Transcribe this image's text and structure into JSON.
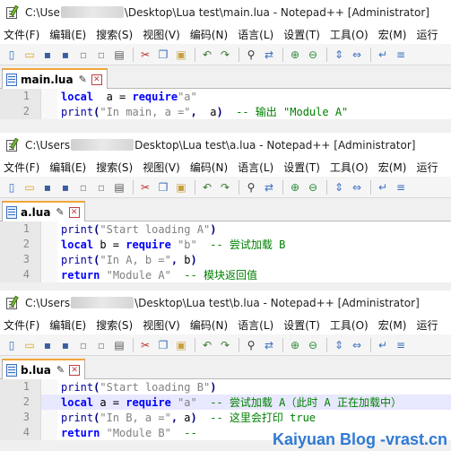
{
  "windows": [
    {
      "title_prefix": "C:\\Use",
      "title_suffix": "\\Desktop\\Lua test\\main.lua - Notepad++ [Administrator]",
      "tab_label": "main.lua",
      "lines": [
        {
          "num": "1",
          "segs": [
            [
              "kw",
              "local"
            ],
            [
              "",
              "  a = "
            ],
            [
              "kw",
              "require"
            ],
            [
              "",
              ""
            ],
            [
              "str",
              "\"a\""
            ]
          ]
        },
        {
          "num": "2",
          "segs": [
            [
              "fn",
              "print"
            ],
            [
              "op",
              "("
            ],
            [
              "str",
              "\"In main, a =\""
            ],
            [
              "op",
              ","
            ],
            [
              "",
              "  a"
            ],
            [
              "op",
              ")"
            ],
            [
              "",
              "  "
            ],
            [
              "cmt",
              "-- 输出 \"Module A\""
            ]
          ]
        }
      ]
    },
    {
      "title_prefix": "C:\\Users",
      "title_suffix": "Desktop\\Lua test\\a.lua - Notepad++ [Administrator]",
      "tab_label": "a.lua",
      "lines": [
        {
          "num": "1",
          "segs": [
            [
              "fn",
              "print"
            ],
            [
              "op",
              "("
            ],
            [
              "str",
              "\"Start loading A\""
            ],
            [
              "op",
              ")"
            ]
          ]
        },
        {
          "num": "2",
          "segs": [
            [
              "kw",
              "local"
            ],
            [
              "",
              " b = "
            ],
            [
              "kw",
              "require"
            ],
            [
              "",
              " "
            ],
            [
              "str",
              "\"b\""
            ],
            [
              "",
              "  "
            ],
            [
              "cmt",
              "-- 尝试加载 B"
            ]
          ]
        },
        {
          "num": "3",
          "segs": [
            [
              "fn",
              "print"
            ],
            [
              "op",
              "("
            ],
            [
              "str",
              "\"In A, b =\""
            ],
            [
              "op",
              ","
            ],
            [
              "",
              " b"
            ],
            [
              "op",
              ")"
            ]
          ]
        },
        {
          "num": "4",
          "segs": [
            [
              "kw",
              "return"
            ],
            [
              "",
              " "
            ],
            [
              "str",
              "\"Module A\""
            ],
            [
              "",
              "  "
            ],
            [
              "cmt",
              "-- 模块返回值"
            ]
          ]
        }
      ]
    },
    {
      "title_prefix": "C:\\Users",
      "title_suffix": "\\Desktop\\Lua test\\b.lua - Notepad++ [Administrator]",
      "tab_label": "b.lua",
      "lines": [
        {
          "num": "1",
          "segs": [
            [
              "fn",
              "print"
            ],
            [
              "op",
              "("
            ],
            [
              "str",
              "\"Start loading B\""
            ],
            [
              "op",
              ")"
            ]
          ]
        },
        {
          "num": "2",
          "segs": [
            [
              "kw",
              "local"
            ],
            [
              "",
              " a = "
            ],
            [
              "kw",
              "require"
            ],
            [
              "",
              " "
            ],
            [
              "str",
              "\"a\""
            ],
            [
              "",
              "  "
            ],
            [
              "cmt",
              "-- 尝试加载 A（此时 A 正在加载中）"
            ]
          ]
        },
        {
          "num": "3",
          "segs": [
            [
              "fn",
              "print"
            ],
            [
              "op",
              "("
            ],
            [
              "str",
              "\"In B, a =\""
            ],
            [
              "op",
              ","
            ],
            [
              "",
              " a"
            ],
            [
              "op",
              ")"
            ],
            [
              "",
              "  "
            ],
            [
              "cmt",
              "-- 这里会打印 true"
            ]
          ]
        },
        {
          "num": "4",
          "segs": [
            [
              "kw",
              "return"
            ],
            [
              "",
              " "
            ],
            [
              "str",
              "\"Module B\""
            ],
            [
              "",
              "  "
            ],
            [
              "cmt",
              "--"
            ]
          ]
        }
      ]
    }
  ],
  "menu": [
    "文件(F)",
    "编辑(E)",
    "搜索(S)",
    "视图(V)",
    "编码(N)",
    "语言(L)",
    "设置(T)",
    "工具(O)",
    "宏(M)",
    "运行"
  ],
  "toolbar_icons": [
    "new-file-icon",
    "open-file-icon",
    "save-icon",
    "save-all-icon",
    "close-icon",
    "close-all-icon",
    "print-icon",
    "cut-icon",
    "copy-icon",
    "paste-icon",
    "undo-icon",
    "redo-icon",
    "find-icon",
    "replace-icon",
    "zoom-in-icon",
    "zoom-out-icon",
    "sync-v-icon",
    "sync-h-icon",
    "wrap-icon",
    "indent-icon"
  ],
  "watermark": "Kaiyuan Blog -vrast.cn",
  "pin_glyph": "✎",
  "close_glyph": "✕"
}
